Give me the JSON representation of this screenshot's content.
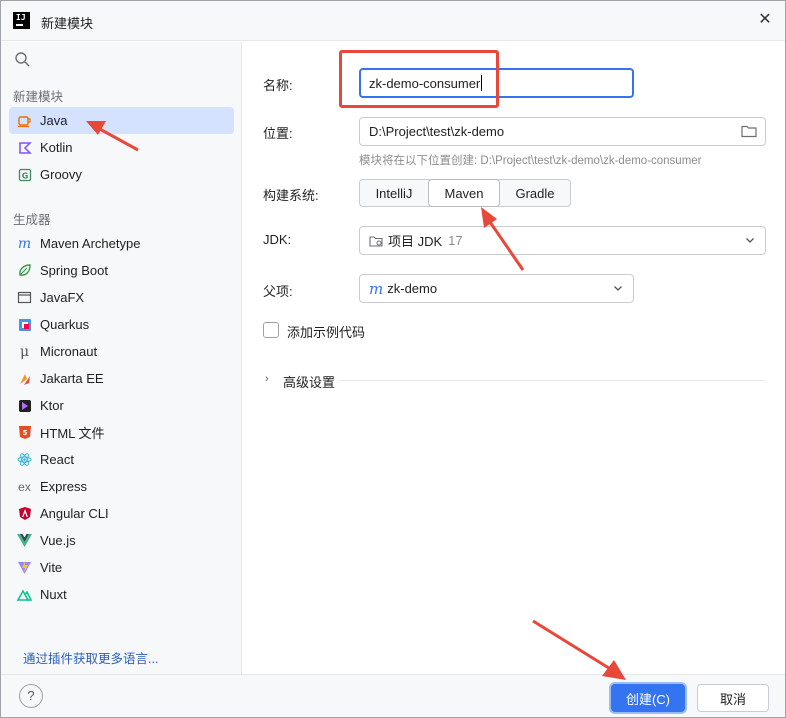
{
  "window": {
    "title": "新建模块",
    "logo_text": "IJ"
  },
  "sidebar": {
    "search_placeholder": "",
    "section_new_module": "新建模块",
    "section_generators": "生成器",
    "languages": [
      {
        "label": "Java",
        "icon": "java-cup-icon",
        "selected": true
      },
      {
        "label": "Kotlin",
        "icon": "kotlin-icon"
      },
      {
        "label": "Groovy",
        "icon": "groovy-icon"
      }
    ],
    "generators": [
      {
        "label": "Maven Archetype",
        "icon": "maven-icon"
      },
      {
        "label": "Spring Boot",
        "icon": "spring-boot-icon"
      },
      {
        "label": "JavaFX",
        "icon": "javafx-icon"
      },
      {
        "label": "Quarkus",
        "icon": "quarkus-icon"
      },
      {
        "label": "Micronaut",
        "icon": "micronaut-icon"
      },
      {
        "label": "Jakarta EE",
        "icon": "jakarta-ee-icon"
      },
      {
        "label": "Ktor",
        "icon": "ktor-icon"
      },
      {
        "label": "HTML 文件",
        "icon": "html5-icon"
      },
      {
        "label": "React",
        "icon": "react-icon"
      },
      {
        "label": "Express",
        "icon": "express-icon"
      },
      {
        "label": "Angular CLI",
        "icon": "angular-icon"
      },
      {
        "label": "Vue.js",
        "icon": "vue-icon"
      },
      {
        "label": "Vite",
        "icon": "vite-icon"
      },
      {
        "label": "Nuxt",
        "icon": "nuxt-icon"
      }
    ],
    "plugins_link": "通过插件获取更多语言..."
  },
  "form": {
    "name_label": "名称:",
    "name_value": "zk-demo-consumer",
    "location_label": "位置:",
    "location_value": "D:\\Project\\test\\zk-demo",
    "location_hint": "模块将在以下位置创建: D:\\Project\\test\\zk-demo\\zk-demo-consumer",
    "build_label": "构建系统:",
    "build_options": [
      "IntelliJ",
      "Maven",
      "Gradle"
    ],
    "build_selected": "Maven",
    "jdk_label": "JDK:",
    "jdk_value": "项目 JDK",
    "jdk_version": "17",
    "parent_label": "父项:",
    "parent_value": "zk-demo",
    "sample_code_label": "添加示例代码",
    "sample_code_checked": false,
    "advanced_label": "高级设置"
  },
  "footer": {
    "help": "?",
    "create_label": "创建(C)",
    "cancel_label": "取消"
  },
  "colors": {
    "accent": "#3574f0",
    "selection": "#d4e2ff",
    "annotation": "#e8483a"
  }
}
